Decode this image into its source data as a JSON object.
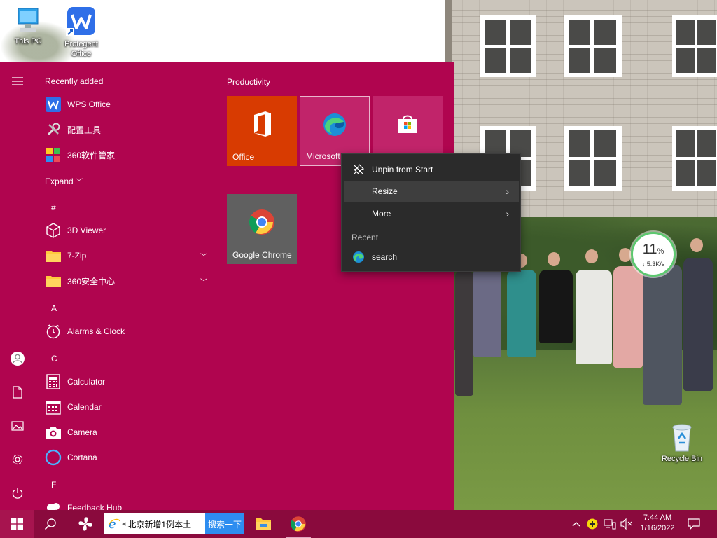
{
  "desktop": {
    "icons": [
      {
        "label": "This PC",
        "icon": "computer-icon"
      },
      {
        "label": "Protegent Office",
        "icon": "wps-shortcut-icon"
      },
      {
        "label": "Recycle Bin",
        "icon": "recycle-bin-icon"
      }
    ]
  },
  "start_menu": {
    "rail": [
      "hamburger-icon",
      "user-icon",
      "documents-icon",
      "pictures-icon",
      "settings-icon",
      "power-icon"
    ],
    "recently_added_title": "Recently added",
    "recent_apps": [
      {
        "label": "WPS Office",
        "icon": "wps-icon"
      },
      {
        "label": "配置工具",
        "icon": "tools-icon"
      },
      {
        "label": "360软件管家",
        "icon": "360-software-icon"
      }
    ],
    "expand_label": "Expand",
    "groups": [
      {
        "letter": "#",
        "apps": [
          {
            "label": "3D Viewer",
            "icon": "cube-icon",
            "expandable": false
          },
          {
            "label": "7-Zip",
            "icon": "folder-icon",
            "expandable": true
          },
          {
            "label": "360安全中心",
            "icon": "folder-icon",
            "expandable": true
          }
        ]
      },
      {
        "letter": "A",
        "apps": [
          {
            "label": "Alarms & Clock",
            "icon": "alarm-clock-icon",
            "expandable": false
          }
        ]
      },
      {
        "letter": "C",
        "apps": [
          {
            "label": "Calculator",
            "icon": "calculator-icon",
            "expandable": false
          },
          {
            "label": "Calendar",
            "icon": "calendar-icon",
            "expandable": false
          },
          {
            "label": "Camera",
            "icon": "camera-icon",
            "expandable": false
          },
          {
            "label": "Cortana",
            "icon": "cortana-icon",
            "expandable": false
          }
        ]
      },
      {
        "letter": "F",
        "apps": [
          {
            "label": "Feedback Hub",
            "icon": "feedback-icon",
            "expandable": false
          }
        ]
      }
    ],
    "tiles_group_title": "Productivity",
    "tiles": [
      {
        "label": "Office",
        "icon": "office-icon",
        "color": "#d83b01"
      },
      {
        "label": "Microsoft Edge",
        "icon": "edge-icon",
        "color": "#c1246a"
      },
      {
        "label": "",
        "icon": "store-icon",
        "color": "#c1246a"
      },
      {
        "label": "Google Chrome",
        "icon": "chrome-icon",
        "color": "#606060"
      }
    ]
  },
  "context_menu": {
    "items": [
      {
        "label": "Unpin from Start",
        "icon": "unpin-icon",
        "submenu": false
      },
      {
        "label": "Resize",
        "icon": "",
        "submenu": true
      },
      {
        "label": "More",
        "icon": "",
        "submenu": true
      }
    ],
    "recent_title": "Recent",
    "recent_items": [
      {
        "label": "search",
        "icon": "edge-icon"
      }
    ]
  },
  "net_monitor": {
    "percent": "11",
    "percent_unit": "%",
    "speed": "↓ 5.3K/s"
  },
  "taskbar": {
    "search_text": "北京新增1例本土",
    "search_button": "搜索一下",
    "time": "7:44 AM",
    "date": "1/16/2022"
  },
  "colors": {
    "start_bg": "#b0054f",
    "taskbar_bg": "#8a0a3d",
    "context_bg": "#2b2b2b",
    "office_tile": "#d83b01",
    "search_button": "#2d8df0"
  }
}
